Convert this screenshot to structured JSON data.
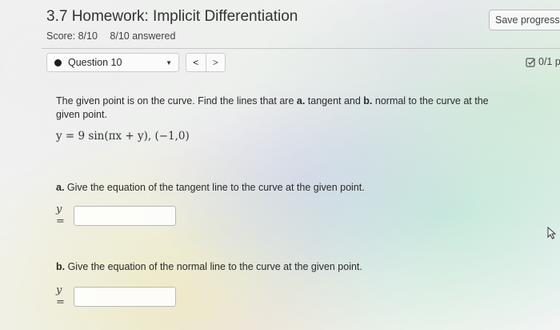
{
  "header": {
    "title": "3.7 Homework: Implicit Differentiation",
    "score": "Score: 8/10",
    "answered": "8/10 answered",
    "save_label": "Save progress"
  },
  "nav": {
    "question_label": "Question 10",
    "prev_symbol": "<",
    "next_symbol": ">",
    "points": "0/1 p"
  },
  "question": {
    "prompt_1": "The given point is on the curve. Find the lines that are ",
    "prompt_a": "a.",
    "prompt_2": " tangent and ",
    "prompt_b": "b.",
    "prompt_3": " normal to the curve at the given point.",
    "equation": "y = 9 sin(πx + y),  (−1,0)"
  },
  "part_a": {
    "letter": "a.",
    "text": " Give the equation of the tangent line to the curve at the given point.",
    "y_label": "y =",
    "value": ""
  },
  "part_b": {
    "letter": "b.",
    "text": " Give the equation of the normal line to the curve at the given point.",
    "y_label": "y =",
    "value": ""
  },
  "icons": {
    "points": "checkbox-edit-icon",
    "cursor": "mouse-pointer-icon"
  },
  "colors": {
    "dot": "#1d1d1d",
    "border": "#b9b9b9"
  }
}
